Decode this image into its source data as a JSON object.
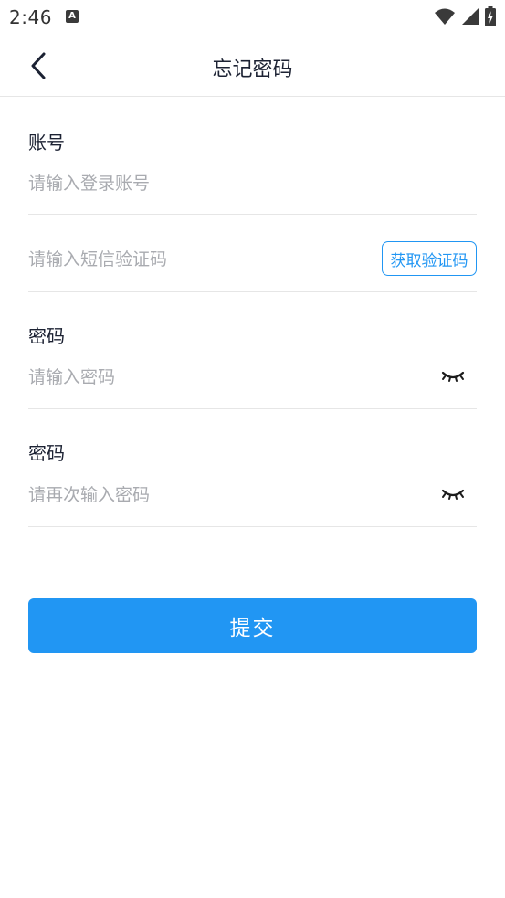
{
  "status_bar": {
    "time": "2:46",
    "notification_letter": "A",
    "icons": [
      "notification-a-icon",
      "wifi-icon",
      "signal-icon",
      "battery-charging-icon"
    ]
  },
  "header": {
    "title": "忘记密码",
    "back_icon": "chevron-left-icon"
  },
  "form": {
    "account": {
      "label": "账号",
      "placeholder": "请输入登录账号",
      "value": ""
    },
    "sms_code": {
      "placeholder": "请输入短信验证码",
      "value": "",
      "button_label": "获取验证码"
    },
    "password": {
      "label": "密码",
      "placeholder": "请输入密码",
      "value": "",
      "toggle_icon": "eye-closed-icon"
    },
    "confirm_password": {
      "label": "密码",
      "placeholder": "请再次输入密码",
      "value": "",
      "toggle_icon": "eye-closed-icon"
    },
    "submit_label": "提交"
  },
  "colors": {
    "accent": "#2196f3",
    "divider": "#e6e6e6",
    "placeholder": "#a9abb0",
    "text": "#1c2233"
  }
}
